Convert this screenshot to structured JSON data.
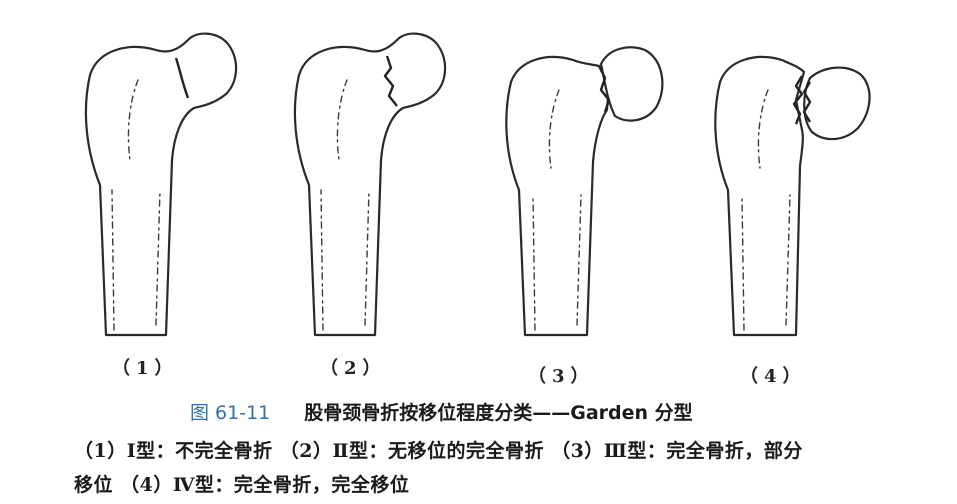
{
  "figures": [
    {
      "label": "（1）"
    },
    {
      "label": "（2）"
    },
    {
      "label": "（3）"
    },
    {
      "label": "（4）"
    }
  ],
  "caption": {
    "number": "图 61-11",
    "title": "股骨颈骨折按移位程度分类——Garden 分型"
  },
  "description": {
    "line1": "（1）Ⅰ型：不完全骨折 （2）Ⅱ型：无移位的完全骨折 （3）Ⅲ型：完全骨折，部分",
    "line2": "移位 （4）Ⅳ型：完全骨折，完全移位"
  }
}
